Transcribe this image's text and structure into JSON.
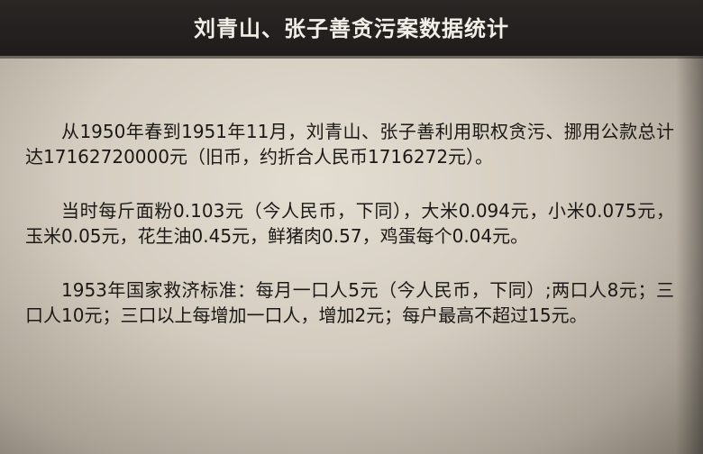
{
  "header": {
    "title": "刘青山、张子善贪污案数据统计"
  },
  "paragraphs": [
    "从1950年春到1951年11月，刘青山、张子善利用职权贪污、挪用公款总计达17162720000元（旧币，约折合人民币1716272元）。",
    "当时每斤面粉0.103元（今人民币，下同），大米0.094元，小米0.075元，玉米0.05元，花生油0.45元，鲜猪肉0.57，鸡蛋每个0.04元。",
    "1953年国家救济标准：每月一口人5元（今人民币，下同）;两口人8元；三口人10元；三口以上每增加一口人，增加2元；每户最高不超过15元。"
  ]
}
